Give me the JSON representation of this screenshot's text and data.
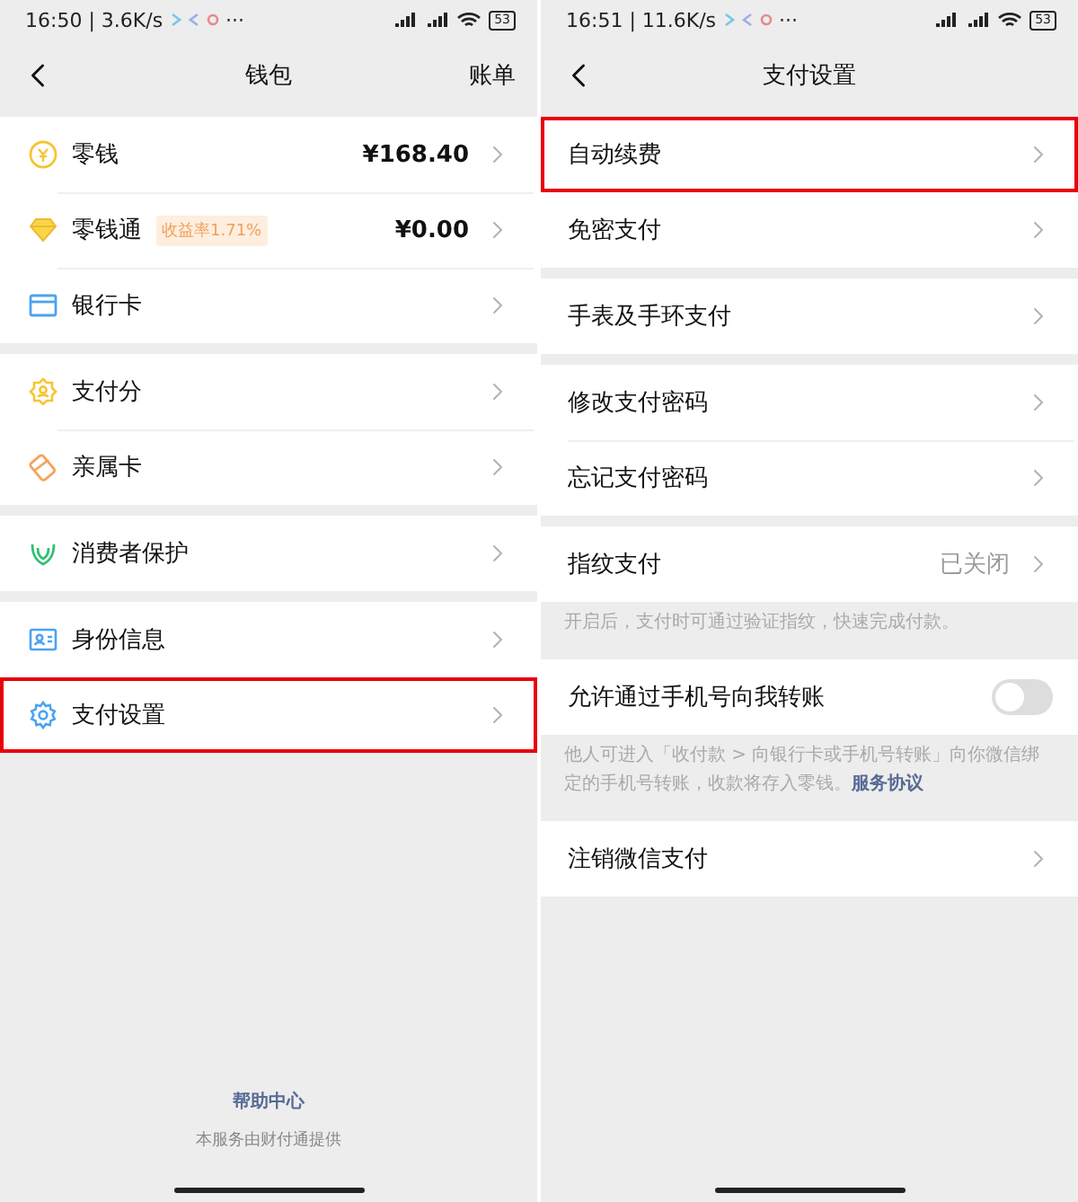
{
  "screens": [
    {
      "status_bar": {
        "time": "16:50 | 3.6K/s",
        "more": "···",
        "battery": "53"
      },
      "nav": {
        "title": "钱包",
        "action": "账单"
      },
      "icons": true,
      "sections": [
        {
          "items": [
            {
              "kind": "link",
              "label": "零钱",
              "value": "¥168.40",
              "highlighted": false
            },
            {
              "kind": "link",
              "label": "零钱通",
              "badge": "收益率1.71%",
              "value": "¥0.00",
              "highlighted": false
            },
            {
              "kind": "link",
              "label": "银行卡",
              "highlighted": false
            }
          ]
        },
        {
          "items": [
            {
              "kind": "link",
              "label": "支付分",
              "highlighted": false
            },
            {
              "kind": "link",
              "label": "亲属卡",
              "highlighted": false
            }
          ]
        },
        {
          "items": [
            {
              "kind": "link",
              "label": "消费者保护",
              "highlighted": false
            }
          ]
        },
        {
          "items": [
            {
              "kind": "link",
              "label": "身份信息",
              "highlighted": false
            },
            {
              "kind": "link",
              "label": "支付设置",
              "highlighted": true
            }
          ]
        }
      ],
      "footer": {
        "link": "帮助中心",
        "note": "本服务由财付通提供"
      }
    },
    {
      "status_bar": {
        "time": "16:51 | 11.6K/s",
        "more": "···",
        "battery": "53"
      },
      "nav": {
        "title": "支付设置"
      },
      "icons": false,
      "sections": [
        {
          "items": [
            {
              "kind": "link",
              "label": "自动续费",
              "highlighted": true
            },
            {
              "kind": "link",
              "label": "免密支付",
              "highlighted": false
            }
          ]
        },
        {
          "items": [
            {
              "kind": "link",
              "label": "手表及手环支付",
              "highlighted": false
            }
          ]
        },
        {
          "items": [
            {
              "kind": "link",
              "label": "修改支付密码",
              "highlighted": false
            },
            {
              "kind": "link",
              "label": "忘记支付密码",
              "highlighted": false
            }
          ]
        },
        {
          "items": [
            {
              "kind": "link",
              "label": "指纹支付",
              "value": "已关闭",
              "highlighted": false
            }
          ],
          "note": {
            "text": "开启后，支付时可通过验证指纹，快速完成付款。"
          }
        },
        {
          "items": [
            {
              "kind": "toggle",
              "label": "允许通过手机号向我转账",
              "on": false,
              "highlighted": false
            }
          ],
          "note": {
            "text": "他人可进入「收付款 > 向银行卡或手机号转账」向你微信绑定的手机号转账，收款将存入零钱。",
            "link": "服务协议"
          }
        },
        {
          "items": [
            {
              "kind": "link",
              "label": "注销微信支付",
              "highlighted": false
            }
          ]
        }
      ]
    }
  ]
}
